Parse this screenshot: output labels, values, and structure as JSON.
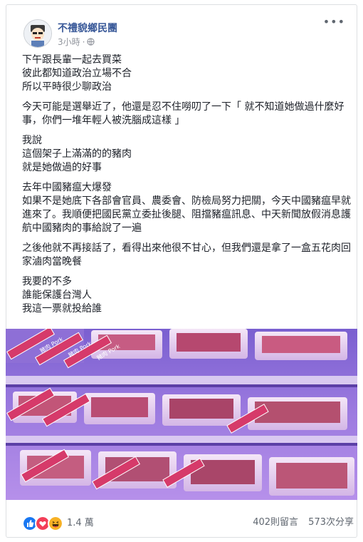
{
  "post": {
    "page_name": "不禮貌鄉民團",
    "timestamp": "3小時",
    "separator": "·",
    "paragraphs": [
      "下午跟長輩一起去買菜\n彼此都知道政治立場不合\n所以平時很少聊政治",
      "今天可能是選舉近了，他還是忍不住嘮叨了一下「 就不知道她做過什麼好事，你們一堆年輕人被洗腦成這樣 」",
      "我說\n這個架子上滿滿的的豬肉\n就是她做過的好事",
      "去年中國豬瘟大爆發\n如果不是她底下各部會官員、農委會、防檢局努力把關，今天中國豬瘟早就進來了。我順便把國民黨立委扯後腿、阻擋豬瘟訊息、中天新聞放假消息護航中國豬肉的事給說了一遍",
      "之後他就不再接話了，看得出來他很不甘心，但我們還是拿了一盒五花肉回家滷肉當晚餐",
      "我要的不多\n誰能保護台灣人\n我這一票就投給誰"
    ],
    "photo_label": "豬肉 Pork"
  },
  "footer": {
    "reaction_count": "1.4 萬",
    "comments": "402則留言",
    "shares": "573次分享"
  },
  "icons": {
    "like": "like-icon",
    "love": "love-icon",
    "haha": "haha-icon",
    "globe": "globe-icon",
    "more": "more-options-icon"
  },
  "colors": {
    "brand_link": "#385898",
    "like_blue": "#1877f2",
    "love_red": "#f33e58",
    "haha_yellow": "#f7b125",
    "photo_pink": "#d63a6a",
    "photo_purple": "#8c6bd6"
  }
}
